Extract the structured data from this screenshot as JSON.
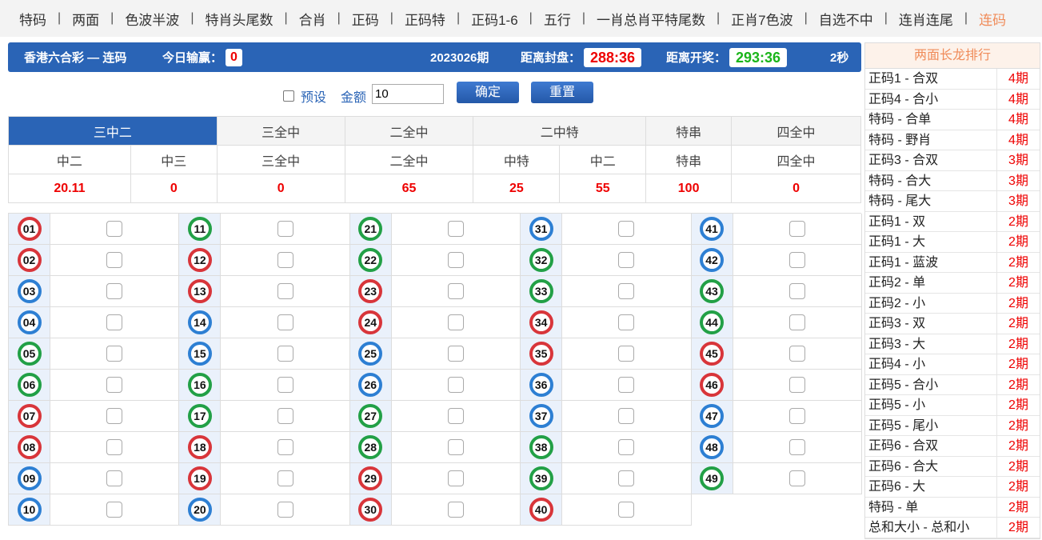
{
  "nav": {
    "items": [
      "特码",
      "两面",
      "色波半波",
      "特肖头尾数",
      "合肖",
      "正码",
      "正码特",
      "正码1-6",
      "五行",
      "一肖总肖平特尾数",
      "正肖7色波",
      "自选不中",
      "连肖连尾",
      "连码"
    ],
    "active_index": 13
  },
  "infobar": {
    "game_title": "香港六合彩 — 连码",
    "today_label": "今日输赢：",
    "today_value": "0",
    "period": "2023026期",
    "close_label": "距离封盘：",
    "close_timer": "288:36",
    "open_label": "距离开奖：",
    "open_timer": "293:36",
    "refresh": "2秒"
  },
  "controls": {
    "preset_label": "预设",
    "amount_label": "金额",
    "amount_value": "10",
    "confirm_label": "确定",
    "reset_label": "重置"
  },
  "odds": {
    "types": [
      {
        "label": "三中二",
        "active": true
      },
      {
        "label": "三全中",
        "active": false
      },
      {
        "label": "二全中",
        "active": false
      },
      {
        "label": "二中特",
        "active": false
      },
      {
        "label": "特串",
        "active": false
      },
      {
        "label": "四全中",
        "active": false
      }
    ],
    "subtypes": [
      "中二",
      "中三",
      "三全中",
      "二全中",
      "中特",
      "中二",
      "特串",
      "四全中"
    ],
    "values": [
      "20.11",
      "0",
      "0",
      "65",
      "25",
      "55",
      "100",
      "0"
    ]
  },
  "balls": [
    {
      "n": "01",
      "c": "red"
    },
    {
      "n": "02",
      "c": "red"
    },
    {
      "n": "03",
      "c": "blue"
    },
    {
      "n": "04",
      "c": "blue"
    },
    {
      "n": "05",
      "c": "green"
    },
    {
      "n": "06",
      "c": "green"
    },
    {
      "n": "07",
      "c": "red"
    },
    {
      "n": "08",
      "c": "red"
    },
    {
      "n": "09",
      "c": "blue"
    },
    {
      "n": "10",
      "c": "blue"
    },
    {
      "n": "11",
      "c": "green"
    },
    {
      "n": "12",
      "c": "red"
    },
    {
      "n": "13",
      "c": "red"
    },
    {
      "n": "14",
      "c": "blue"
    },
    {
      "n": "15",
      "c": "blue"
    },
    {
      "n": "16",
      "c": "green"
    },
    {
      "n": "17",
      "c": "green"
    },
    {
      "n": "18",
      "c": "red"
    },
    {
      "n": "19",
      "c": "red"
    },
    {
      "n": "20",
      "c": "blue"
    },
    {
      "n": "21",
      "c": "green"
    },
    {
      "n": "22",
      "c": "green"
    },
    {
      "n": "23",
      "c": "red"
    },
    {
      "n": "24",
      "c": "red"
    },
    {
      "n": "25",
      "c": "blue"
    },
    {
      "n": "26",
      "c": "blue"
    },
    {
      "n": "27",
      "c": "green"
    },
    {
      "n": "28",
      "c": "green"
    },
    {
      "n": "29",
      "c": "red"
    },
    {
      "n": "30",
      "c": "red"
    },
    {
      "n": "31",
      "c": "blue"
    },
    {
      "n": "32",
      "c": "green"
    },
    {
      "n": "33",
      "c": "green"
    },
    {
      "n": "34",
      "c": "red"
    },
    {
      "n": "35",
      "c": "red"
    },
    {
      "n": "36",
      "c": "blue"
    },
    {
      "n": "37",
      "c": "blue"
    },
    {
      "n": "38",
      "c": "green"
    },
    {
      "n": "39",
      "c": "green"
    },
    {
      "n": "40",
      "c": "red"
    },
    {
      "n": "41",
      "c": "blue"
    },
    {
      "n": "42",
      "c": "blue"
    },
    {
      "n": "43",
      "c": "green"
    },
    {
      "n": "44",
      "c": "green"
    },
    {
      "n": "45",
      "c": "red"
    },
    {
      "n": "46",
      "c": "red"
    },
    {
      "n": "47",
      "c": "blue"
    },
    {
      "n": "48",
      "c": "blue"
    },
    {
      "n": "49",
      "c": "green"
    }
  ],
  "ball_colors": {
    "red": "#d8353a",
    "blue": "#2d7fd3",
    "green": "#22a046"
  },
  "sidebar": {
    "title": "两面长龙排行",
    "rows": [
      {
        "name": "正码1 - 合双",
        "count": "4期"
      },
      {
        "name": "正码4 - 合小",
        "count": "4期"
      },
      {
        "name": "特码 - 合单",
        "count": "4期"
      },
      {
        "name": "特码 - 野肖",
        "count": "4期"
      },
      {
        "name": "正码3 - 合双",
        "count": "3期"
      },
      {
        "name": "特码 - 合大",
        "count": "3期"
      },
      {
        "name": "特码 - 尾大",
        "count": "3期"
      },
      {
        "name": "正码1 - 双",
        "count": "2期"
      },
      {
        "name": "正码1 - 大",
        "count": "2期"
      },
      {
        "name": "正码1 - 蓝波",
        "count": "2期"
      },
      {
        "name": "正码2 - 单",
        "count": "2期"
      },
      {
        "name": "正码2 - 小",
        "count": "2期"
      },
      {
        "name": "正码3 - 双",
        "count": "2期"
      },
      {
        "name": "正码3 - 大",
        "count": "2期"
      },
      {
        "name": "正码4 - 小",
        "count": "2期"
      },
      {
        "name": "正码5 - 合小",
        "count": "2期"
      },
      {
        "name": "正码5 - 小",
        "count": "2期"
      },
      {
        "name": "正码5 - 尾小",
        "count": "2期"
      },
      {
        "name": "正码6 - 合双",
        "count": "2期"
      },
      {
        "name": "正码6 - 合大",
        "count": "2期"
      },
      {
        "name": "正码6 - 大",
        "count": "2期"
      },
      {
        "name": "特码 - 单",
        "count": "2期"
      },
      {
        "name": "总和大小 - 总和小",
        "count": "2期"
      }
    ]
  }
}
